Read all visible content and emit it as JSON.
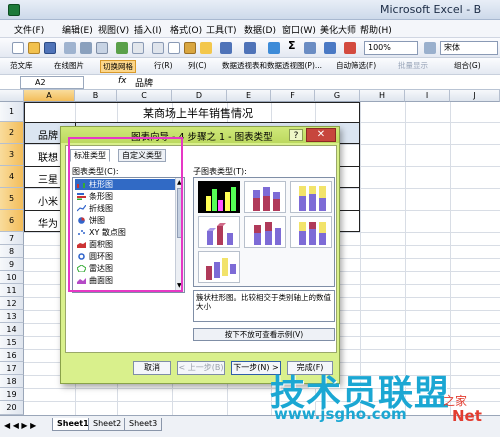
{
  "app": {
    "title": "Microsoft Excel - B"
  },
  "menu": [
    "文件(F)",
    "编辑(E)",
    "视图(V)",
    "插入(I)",
    "格式(O)",
    "工具(T)",
    "数据(D)",
    "窗口(W)",
    "美化大师",
    "帮助(H)"
  ],
  "toolbar": {
    "zoom": "100%",
    "font": "宋体"
  },
  "toolbar2": {
    "item1": "范文库",
    "item2": "在线图片",
    "item3": "切换网格",
    "item4": "行(R)",
    "item5": "列(C)",
    "item6": "数据透视表和数据透视图(P)...",
    "item7": "自动筛选(F)",
    "item8": "批量显示",
    "item9": "组合(G)"
  },
  "formula_bar": {
    "cell_ref": "A2",
    "fx": "fx",
    "value": "品牌"
  },
  "columns": [
    "A",
    "B",
    "C",
    "D",
    "E",
    "F",
    "G",
    "H",
    "I",
    "J"
  ],
  "rows": [
    "1",
    "2",
    "3",
    "4",
    "5",
    "6",
    "7",
    "8",
    "9",
    "10",
    "11",
    "12",
    "13",
    "14",
    "15",
    "16",
    "17",
    "18",
    "19",
    "20"
  ],
  "sheet": {
    "title": "某商场上半年销售情况",
    "a2": "品牌",
    "brands": [
      "联想",
      "三星",
      "小米",
      "华为"
    ]
  },
  "sheet_tabs": [
    "Sheet1",
    "Sheet2",
    "Sheet3"
  ],
  "tab_nav": "◀ ◀ ▶ ▶",
  "dialog": {
    "title": "图表向导 - 4 步骤之 1 - 图表类型",
    "help": "?",
    "close": "✕",
    "tabs": [
      "标准类型",
      "自定义类型"
    ],
    "type_label": "图表类型(C):",
    "types": [
      "柱形图",
      "条形图",
      "折线图",
      "饼图",
      "XY 散点图",
      "面积图",
      "圆环图",
      "雷达图",
      "曲面图"
    ],
    "subtype_label": "子图表类型(T):",
    "description": "簇状柱形图。比较相交于类别轴上的数值大小",
    "preview_button": "按下不放可查看示例(V)",
    "buttons": {
      "cancel": "取消",
      "back": "< 上一步(B)",
      "next": "下一步(N) >",
      "finish": "完成(F)"
    }
  },
  "watermark": {
    "brand": "技术员联盟",
    "url": "www.jsgho.com",
    "net": "Net",
    "zhi": "之家"
  },
  "icons": [
    "excel-app-icon",
    "new-icon",
    "open-icon",
    "save-icon",
    "print-icon",
    "preview-icon",
    "cut-icon",
    "copy-icon",
    "paste-icon",
    "undo-icon",
    "redo-icon",
    "sum-icon",
    "sort-icon",
    "chart-icon"
  ],
  "colors": {
    "dialog_bg": "#d9f08c",
    "highlight": "#e638c5",
    "selected": "#316ac5",
    "watermark": "#1ba7d3"
  }
}
